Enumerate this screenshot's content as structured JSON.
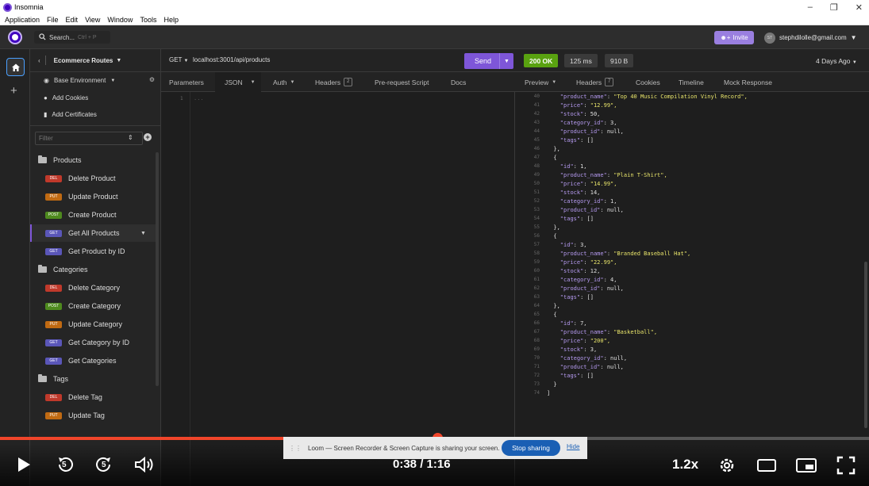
{
  "window": {
    "title": "Insomnia",
    "menu": [
      "Application",
      "File",
      "Edit",
      "View",
      "Window",
      "Tools",
      "Help"
    ]
  },
  "header": {
    "search_label": "Search...",
    "search_shortcut": "Ctrl + P",
    "invite_label": "Invite",
    "user_email": "stephdilolle@gmail.com",
    "user_initials": "ST"
  },
  "sidebar": {
    "collection": "Ecommerce Routes",
    "environment": "Base Environment",
    "add_cookies": "Add Cookies",
    "add_certificates": "Add Certificates",
    "filter_placeholder": "Filter",
    "folders": [
      {
        "name": "Products",
        "requests": [
          {
            "method": "DEL",
            "name": "Delete Product"
          },
          {
            "method": "PUT",
            "name": "Update Product"
          },
          {
            "method": "POST",
            "name": "Create Product"
          },
          {
            "method": "GET",
            "name": "Get All Products"
          },
          {
            "method": "GET",
            "name": "Get Product by ID"
          }
        ]
      },
      {
        "name": "Categories",
        "requests": [
          {
            "method": "DEL",
            "name": "Delete Category"
          },
          {
            "method": "POST",
            "name": "Create Category"
          },
          {
            "method": "PUT",
            "name": "Update Category"
          },
          {
            "method": "GET",
            "name": "Get Category by ID"
          },
          {
            "method": "GET",
            "name": "Get Categories"
          }
        ]
      },
      {
        "name": "Tags",
        "requests": [
          {
            "method": "DEL",
            "name": "Delete Tag"
          },
          {
            "method": "PUT",
            "name": "Update Tag"
          }
        ]
      }
    ],
    "method_colors": {
      "DEL": "#c0392b",
      "PUT": "#c06a12",
      "POST": "#4e8a1e",
      "GET": "#5a56b8"
    }
  },
  "request": {
    "method": "GET",
    "url": "localhost:3001/api/products",
    "send_label": "Send",
    "tabs": {
      "parameters": "Parameters",
      "body": "JSON",
      "auth": "Auth",
      "headers": "Headers",
      "headers_count": "2",
      "prerequest": "Pre-request Script",
      "docs": "Docs"
    },
    "editor_line": "1",
    "editor_placeholder": "..."
  },
  "response": {
    "status": "200 OK",
    "time": "125 ms",
    "size": "910 B",
    "ago": "4 Days Ago",
    "tabs": {
      "preview": "Preview",
      "headers": "Headers",
      "headers_count": "7",
      "cookies": "Cookies",
      "timeline": "Timeline",
      "mock": "Mock Response"
    },
    "lines": [
      {
        "n": "40",
        "k": "\"product_name\"",
        "v": "\"Top 40 Music Compilation Vinyl Record\",",
        "str": true,
        "ind": 4
      },
      {
        "n": "41",
        "k": "\"price\"",
        "v": "\"12.99\",",
        "str": true,
        "ind": 4
      },
      {
        "n": "42",
        "k": "\"stock\"",
        "v": "50,",
        "str": false,
        "ind": 4
      },
      {
        "n": "43",
        "k": "\"category_id\"",
        "v": "3,",
        "str": false,
        "ind": 4
      },
      {
        "n": "44",
        "k": "\"product_id\"",
        "v": "null,",
        "str": false,
        "ind": 4
      },
      {
        "n": "45",
        "k": "\"tags\"",
        "v": "[]",
        "str": false,
        "ind": 4
      },
      {
        "n": "46",
        "raw": "},",
        "ind": 2
      },
      {
        "n": "47",
        "raw": "{",
        "ind": 2
      },
      {
        "n": "48",
        "k": "\"id\"",
        "v": "1,",
        "str": false,
        "ind": 4
      },
      {
        "n": "49",
        "k": "\"product_name\"",
        "v": "\"Plain T-Shirt\",",
        "str": true,
        "ind": 4
      },
      {
        "n": "50",
        "k": "\"price\"",
        "v": "\"14.99\",",
        "str": true,
        "ind": 4
      },
      {
        "n": "51",
        "k": "\"stock\"",
        "v": "14,",
        "str": false,
        "ind": 4
      },
      {
        "n": "52",
        "k": "\"category_id\"",
        "v": "1,",
        "str": false,
        "ind": 4
      },
      {
        "n": "53",
        "k": "\"product_id\"",
        "v": "null,",
        "str": false,
        "ind": 4
      },
      {
        "n": "54",
        "k": "\"tags\"",
        "v": "[]",
        "str": false,
        "ind": 4
      },
      {
        "n": "55",
        "raw": "},",
        "ind": 2
      },
      {
        "n": "56",
        "raw": "{",
        "ind": 2
      },
      {
        "n": "57",
        "k": "\"id\"",
        "v": "3,",
        "str": false,
        "ind": 4
      },
      {
        "n": "58",
        "k": "\"product_name\"",
        "v": "\"Branded Baseball Hat\",",
        "str": true,
        "ind": 4
      },
      {
        "n": "59",
        "k": "\"price\"",
        "v": "\"22.99\",",
        "str": true,
        "ind": 4
      },
      {
        "n": "60",
        "k": "\"stock\"",
        "v": "12,",
        "str": false,
        "ind": 4
      },
      {
        "n": "61",
        "k": "\"category_id\"",
        "v": "4,",
        "str": false,
        "ind": 4
      },
      {
        "n": "62",
        "k": "\"product_id\"",
        "v": "null,",
        "str": false,
        "ind": 4
      },
      {
        "n": "63",
        "k": "\"tags\"",
        "v": "[]",
        "str": false,
        "ind": 4
      },
      {
        "n": "64",
        "raw": "},",
        "ind": 2
      },
      {
        "n": "65",
        "raw": "{",
        "ind": 2
      },
      {
        "n": "66",
        "k": "\"id\"",
        "v": "7,",
        "str": false,
        "ind": 4
      },
      {
        "n": "67",
        "k": "\"product_name\"",
        "v": "\"Basketball\",",
        "str": true,
        "ind": 4
      },
      {
        "n": "68",
        "k": "\"price\"",
        "v": "\"200\",",
        "str": true,
        "ind": 4
      },
      {
        "n": "69",
        "k": "\"stock\"",
        "v": "3,",
        "str": false,
        "ind": 4
      },
      {
        "n": "70",
        "k": "\"category_id\"",
        "v": "null,",
        "str": false,
        "ind": 4
      },
      {
        "n": "71",
        "k": "\"product_id\"",
        "v": "null,",
        "str": false,
        "ind": 4
      },
      {
        "n": "72",
        "k": "\"tags\"",
        "v": "[]",
        "str": false,
        "ind": 4
      },
      {
        "n": "73",
        "raw": "}",
        "ind": 2
      },
      {
        "n": "74",
        "raw": "]",
        "ind": 0
      }
    ]
  },
  "video": {
    "progress": 0.503,
    "time_current": "0:38",
    "time_separator": "/",
    "time_total": "1:16",
    "speed": "1.2x",
    "skip_back_seconds": "5",
    "skip_forward_seconds": "5",
    "loom_message": "Loom — Screen Recorder & Screen Capture is sharing your screen.",
    "stop_sharing_label": "Stop sharing",
    "hide_label": "Hide"
  }
}
